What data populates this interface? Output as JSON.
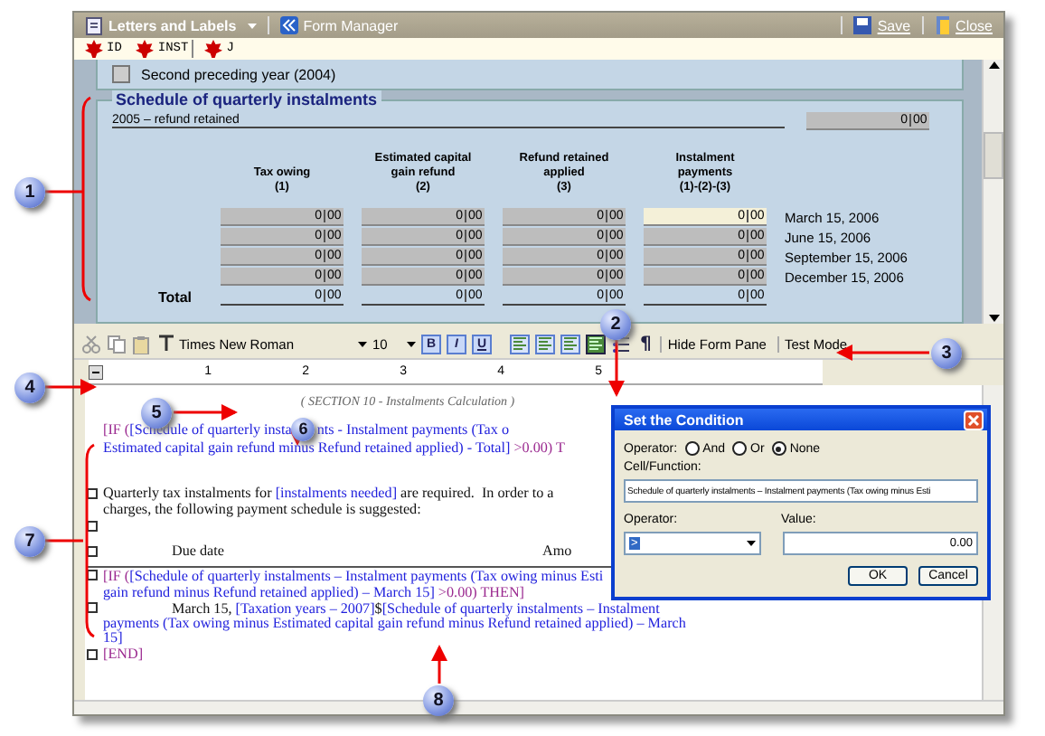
{
  "window": {
    "menu": "Letters and Labels",
    "form_manager": "Form Manager",
    "save": "Save",
    "close": "Close"
  },
  "tags": [
    {
      "label": "ID"
    },
    {
      "label": "INST"
    },
    {
      "label": "J"
    }
  ],
  "form": {
    "previous_year": {
      "label": "Second preceding year (2004)",
      "checked": false
    },
    "section_title": "Schedule of quarterly instalments",
    "retained": {
      "label": "2005 – refund retained",
      "value": "0",
      "cents": "00"
    },
    "columns": [
      {
        "lines": [
          "Tax owing",
          "(1)"
        ]
      },
      {
        "lines": [
          "Estimated capital",
          "gain refund",
          "(2)"
        ]
      },
      {
        "lines": [
          "Refund retained",
          "applied",
          "(3)"
        ]
      },
      {
        "lines": [
          "Instalment",
          "payments",
          "(1)-(2)-(3)"
        ]
      }
    ],
    "rows": [
      {
        "date": "March 15, 2006",
        "cells": [
          {
            "value": "0",
            "cents": "00",
            "selected": false
          },
          {
            "value": "0",
            "cents": "00",
            "selected": false
          },
          {
            "value": "0",
            "cents": "00",
            "selected": false
          },
          {
            "value": "0",
            "cents": "00",
            "selected": true
          }
        ]
      },
      {
        "date": "June 15, 2006",
        "cells": [
          {
            "value": "0",
            "cents": "00",
            "selected": false
          },
          {
            "value": "0",
            "cents": "00",
            "selected": false
          },
          {
            "value": "0",
            "cents": "00",
            "selected": false
          },
          {
            "value": "0",
            "cents": "00",
            "selected": false
          }
        ]
      },
      {
        "date": "September 15, 2006",
        "cells": [
          {
            "value": "0",
            "cents": "00",
            "selected": false
          },
          {
            "value": "0",
            "cents": "00",
            "selected": false
          },
          {
            "value": "0",
            "cents": "00",
            "selected": false
          },
          {
            "value": "0",
            "cents": "00",
            "selected": false
          }
        ]
      },
      {
        "date": "December 15, 2006",
        "cells": [
          {
            "value": "0",
            "cents": "00",
            "selected": false
          },
          {
            "value": "0",
            "cents": "00",
            "selected": false
          },
          {
            "value": "0",
            "cents": "00",
            "selected": false
          },
          {
            "value": "0",
            "cents": "00",
            "selected": false
          }
        ]
      }
    ],
    "total": {
      "label": "Total",
      "cells": [
        {
          "value": "0",
          "cents": "00"
        },
        {
          "value": "0",
          "cents": "00"
        },
        {
          "value": "0",
          "cents": "00"
        },
        {
          "value": "0",
          "cents": "00"
        }
      ]
    }
  },
  "toolbar": {
    "font": "Times New Roman",
    "size": "10",
    "styles": [
      {
        "label": "B"
      },
      {
        "label": "I"
      },
      {
        "label": "U"
      }
    ],
    "alignments": [
      {
        "selected": false
      },
      {
        "selected": false
      },
      {
        "selected": false
      },
      {
        "selected": true
      }
    ],
    "pilcrow": "¶",
    "hide_form_pane": "Hide Form Pane",
    "test_mode": "Test Mode"
  },
  "ruler": [
    "1",
    "2",
    "3",
    "4",
    "5"
  ],
  "document": {
    "section_heading": "( SECTION 10 - Instalments Calculation )",
    "lines": [
      {
        "marker": false,
        "indent": false,
        "segments": [
          {
            "kind": "condition",
            "text": "[IF ("
          },
          {
            "kind": "field",
            "text": "[Schedule of quarterly insta"
          },
          {
            "kind": "callout",
            "text": "6"
          },
          {
            "kind": "field",
            "text": "nts - Instalment payments (Tax o"
          }
        ]
      },
      {
        "marker": false,
        "indent": false,
        "segments": [
          {
            "kind": "field",
            "text": "Estimated capital gain refund minus Refund retained applied) - Total]"
          },
          {
            "kind": "condition",
            "text": " >0.00) T"
          }
        ]
      },
      {
        "marker": false
      },
      {
        "marker": true,
        "indent": false,
        "segments": [
          {
            "kind": "text",
            "text": "Quarterly tax instalments for "
          },
          {
            "kind": "field",
            "text": "[instalments needed]"
          },
          {
            "kind": "text",
            "text": " are required.  In order to a"
          }
        ]
      },
      {
        "marker": false,
        "indent": false,
        "segments": [
          {
            "kind": "text",
            "text": "charges, the following payment schedule is suggested:"
          }
        ]
      },
      {
        "marker": true
      },
      {
        "marker": true,
        "indent": true,
        "kind": "heading",
        "segments": [
          {
            "kind": "text",
            "text": "Due date"
          },
          {
            "kind": "text",
            "text": "Amo"
          }
        ]
      },
      {
        "marker": true,
        "indent": false,
        "segments": [
          {
            "kind": "condition",
            "text": "[IF ("
          },
          {
            "kind": "field",
            "text": "[Schedule of quarterly instalments – Instalment payments (Tax owing minus Esti"
          }
        ]
      },
      {
        "marker": false,
        "indent": false,
        "segments": [
          {
            "kind": "field",
            "text": "gain refund minus Refund retained applied) – March 15]"
          },
          {
            "kind": "condition",
            "text": " >0.00) THEN]"
          }
        ]
      },
      {
        "marker": true,
        "indent": true,
        "segments": [
          {
            "kind": "text",
            "text": "March 15, "
          },
          {
            "kind": "field",
            "text": "[Taxation years – 2007]"
          },
          {
            "kind": "text",
            "text": "$"
          },
          {
            "kind": "field",
            "text": "[Schedule of quarterly instalments – Instalment"
          }
        ]
      },
      {
        "marker": false,
        "indent": false,
        "segments": [
          {
            "kind": "field",
            "text": "payments (Tax owing minus Estimated capital gain refund minus Refund retained applied) – March"
          }
        ]
      },
      {
        "marker": false,
        "indent": false,
        "segments": [
          {
            "kind": "field",
            "text": "15]"
          }
        ]
      },
      {
        "marker": true,
        "indent": false,
        "segments": [
          {
            "kind": "condition",
            "text": "[END]"
          }
        ]
      }
    ]
  },
  "dialog": {
    "title": "Set the Condition",
    "operator_label": "Operator:",
    "logic": [
      {
        "label": "And",
        "selected": false
      },
      {
        "label": "Or",
        "selected": false
      },
      {
        "label": "None",
        "selected": true
      }
    ],
    "cell_label": "Cell/Function:",
    "cell_value": "Schedule of quarterly instalments – Instalment payments (Tax owing minus Esti",
    "compare_label": "Operator:",
    "compare_value": ">",
    "value_label": "Value:",
    "value": "0.00",
    "buttons": [
      "OK",
      "Cancel"
    ]
  },
  "callouts": [
    {
      "number": "1"
    },
    {
      "number": "2"
    },
    {
      "number": "3"
    },
    {
      "number": "4"
    },
    {
      "number": "5"
    },
    {
      "number": "7"
    },
    {
      "number": "8"
    }
  ]
}
